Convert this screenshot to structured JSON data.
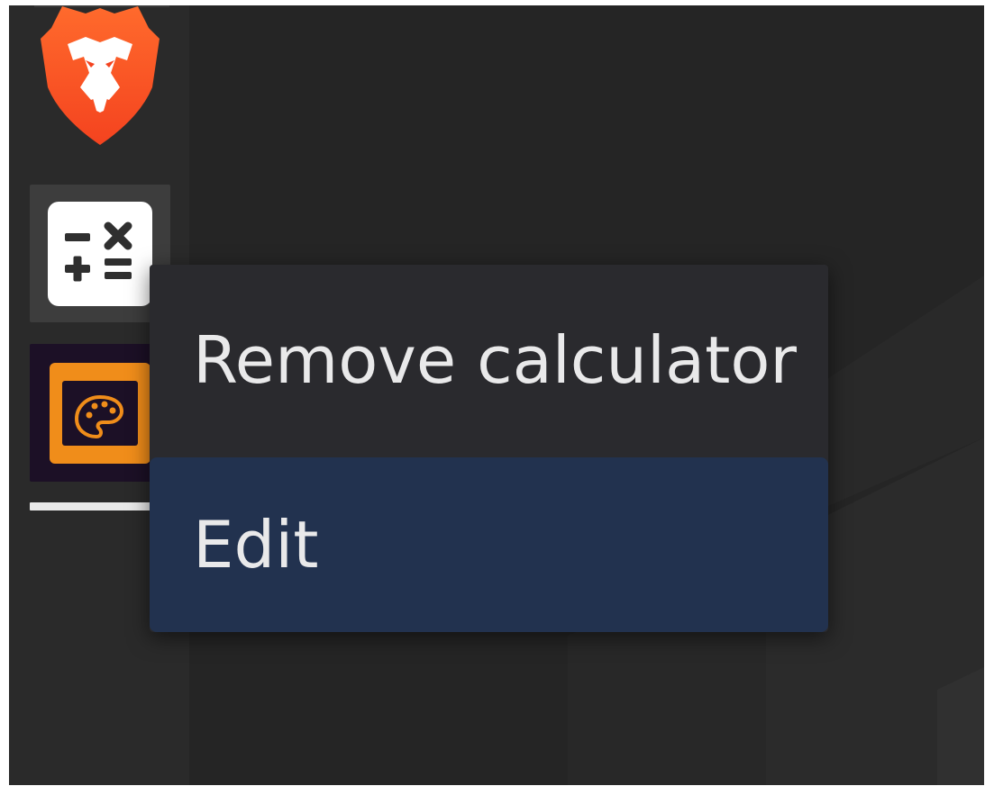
{
  "dock": {
    "items": [
      {
        "name": "browser",
        "icon": "brave-lion-icon",
        "color": "#fb542b"
      },
      {
        "name": "calculator",
        "icon": "calculator-icon",
        "color": "#ffffff"
      },
      {
        "name": "paint",
        "icon": "paint-palette-icon",
        "color": "#f08d1a"
      }
    ]
  },
  "context_menu": {
    "items": [
      {
        "label": "Remove calculator"
      },
      {
        "label": "Edit",
        "highlighted": true
      }
    ]
  },
  "colors": {
    "background": "#252525",
    "menu_background": "#2a2a2e",
    "menu_highlight": "#22324f",
    "menu_text": "#e9e9ea"
  }
}
